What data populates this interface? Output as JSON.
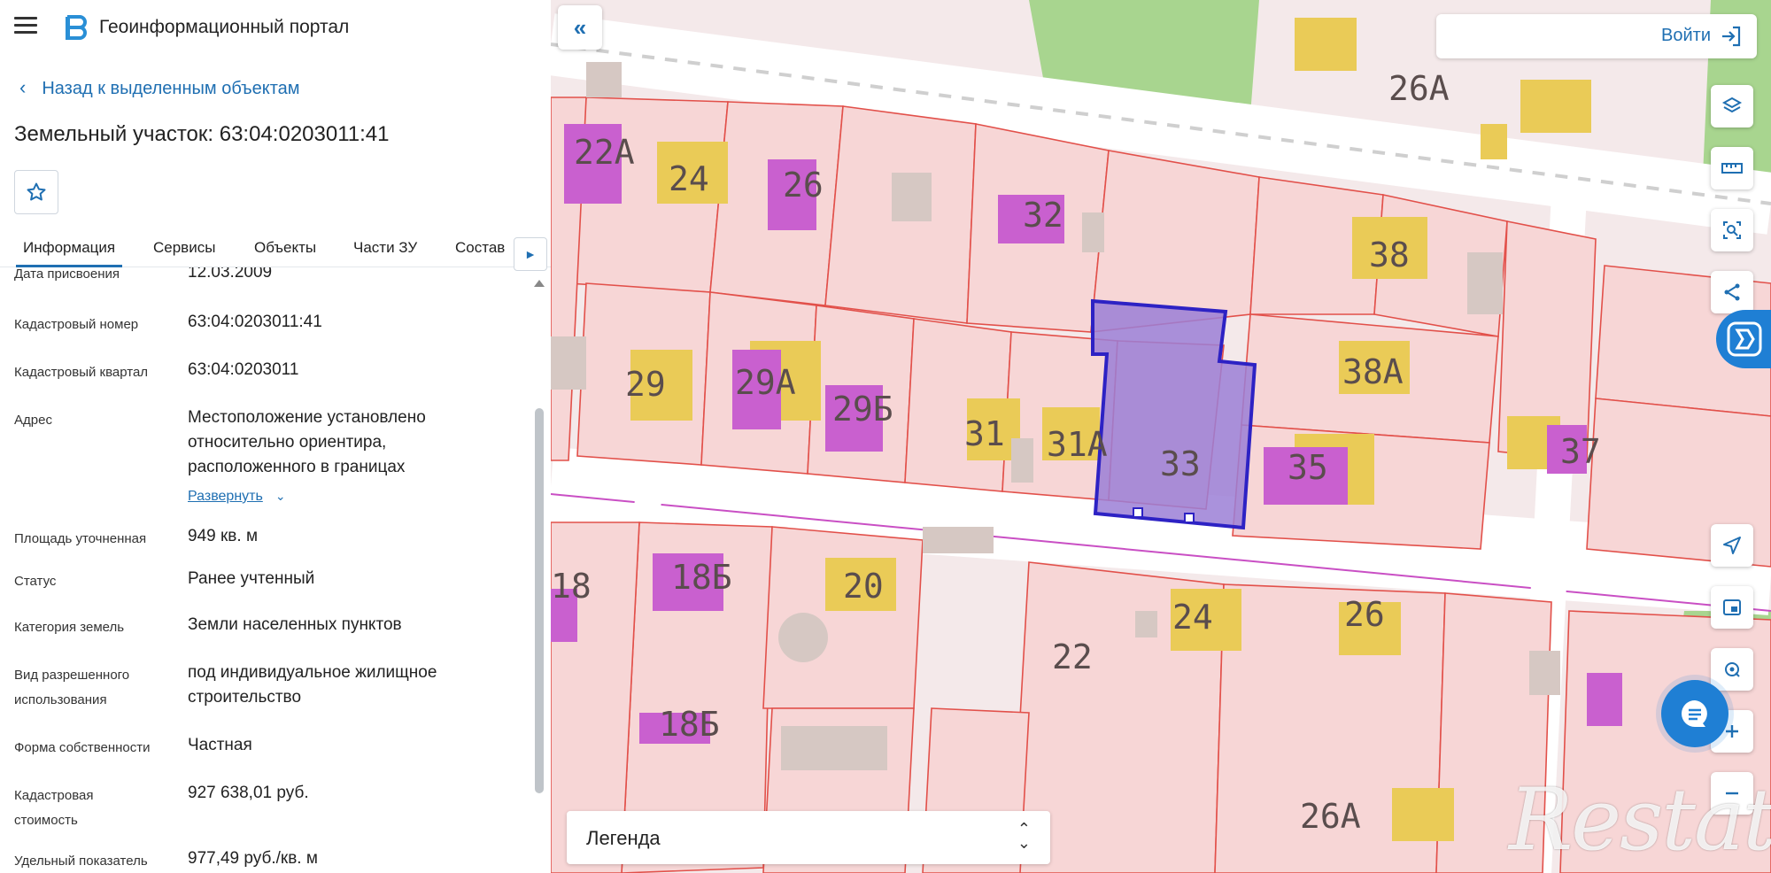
{
  "header": {
    "menu_icon": "hamburger-icon",
    "logo_icon": "portal-logo-icon",
    "title": "Геоинформационный портал"
  },
  "nav": {
    "back_label": "Назад к выделенным объектам"
  },
  "object": {
    "title": "Земельный участок: 63:04:0203011:41",
    "favorite_icon": "star-icon"
  },
  "tabs": [
    {
      "label": "Информация",
      "active": true
    },
    {
      "label": "Сервисы"
    },
    {
      "label": "Объекты"
    },
    {
      "label": "Части ЗУ"
    },
    {
      "label": "Состав"
    }
  ],
  "properties": [
    {
      "label": "Дата присвоения",
      "value": "12.03.2009"
    },
    {
      "label": "Кадастровый номер",
      "value": "63:04:0203011:41"
    },
    {
      "label": "Кадастровый квартал",
      "value": "63:04:0203011"
    },
    {
      "label": "Адрес",
      "value": [
        "Местоположение установлено",
        "относительно ориентира,",
        "расположенного в границах"
      ],
      "expand_label": "Развернуть"
    },
    {
      "label": "Площадь уточненная",
      "value": "949 кв. м"
    },
    {
      "label": "Статус",
      "value": "Ранее учтенный"
    },
    {
      "label": "Категория земель",
      "value": "Земли населенных пунктов"
    },
    {
      "label": [
        "Вид разрешенного",
        "использования"
      ],
      "value": [
        "под индивидуальное жилищное",
        "строительство"
      ]
    },
    {
      "label": "Форма собственности",
      "value": "Частная"
    },
    {
      "label": [
        "Кадастровая",
        "стоимость"
      ],
      "value": "927 638,01 руб."
    },
    {
      "label": "Удельный показатель",
      "value": "977,49 руб./кв. м"
    }
  ],
  "map": {
    "login_label": "Войти",
    "legend_label": "Легенда",
    "parcel_labels": [
      "22А",
      "24",
      "26",
      "32",
      "26А",
      "38",
      "29",
      "29А",
      "29Б",
      "31",
      "31А",
      "33",
      "35",
      "38А",
      "37",
      "18",
      "18Б",
      "20",
      "24",
      "26",
      "22",
      "18Б",
      "26А"
    ],
    "tools": [
      "layers-icon",
      "ruler-icon",
      "select-area-icon",
      "share-icon",
      "panel-icon",
      "locate-icon",
      "print-icon",
      "search-location-icon",
      "zoom-in-icon",
      "zoom-out-icon"
    ],
    "watermark": "Restate",
    "colors": {
      "parcel_fill": "#f7d6d6",
      "parcel_border": "#e2504a",
      "building_yellow": "#eacb57",
      "building_magenta": "#c960cf",
      "selected_parcel": "#9b7fd6",
      "green": "#a8d58f",
      "accent": "#1f6fb2"
    }
  }
}
